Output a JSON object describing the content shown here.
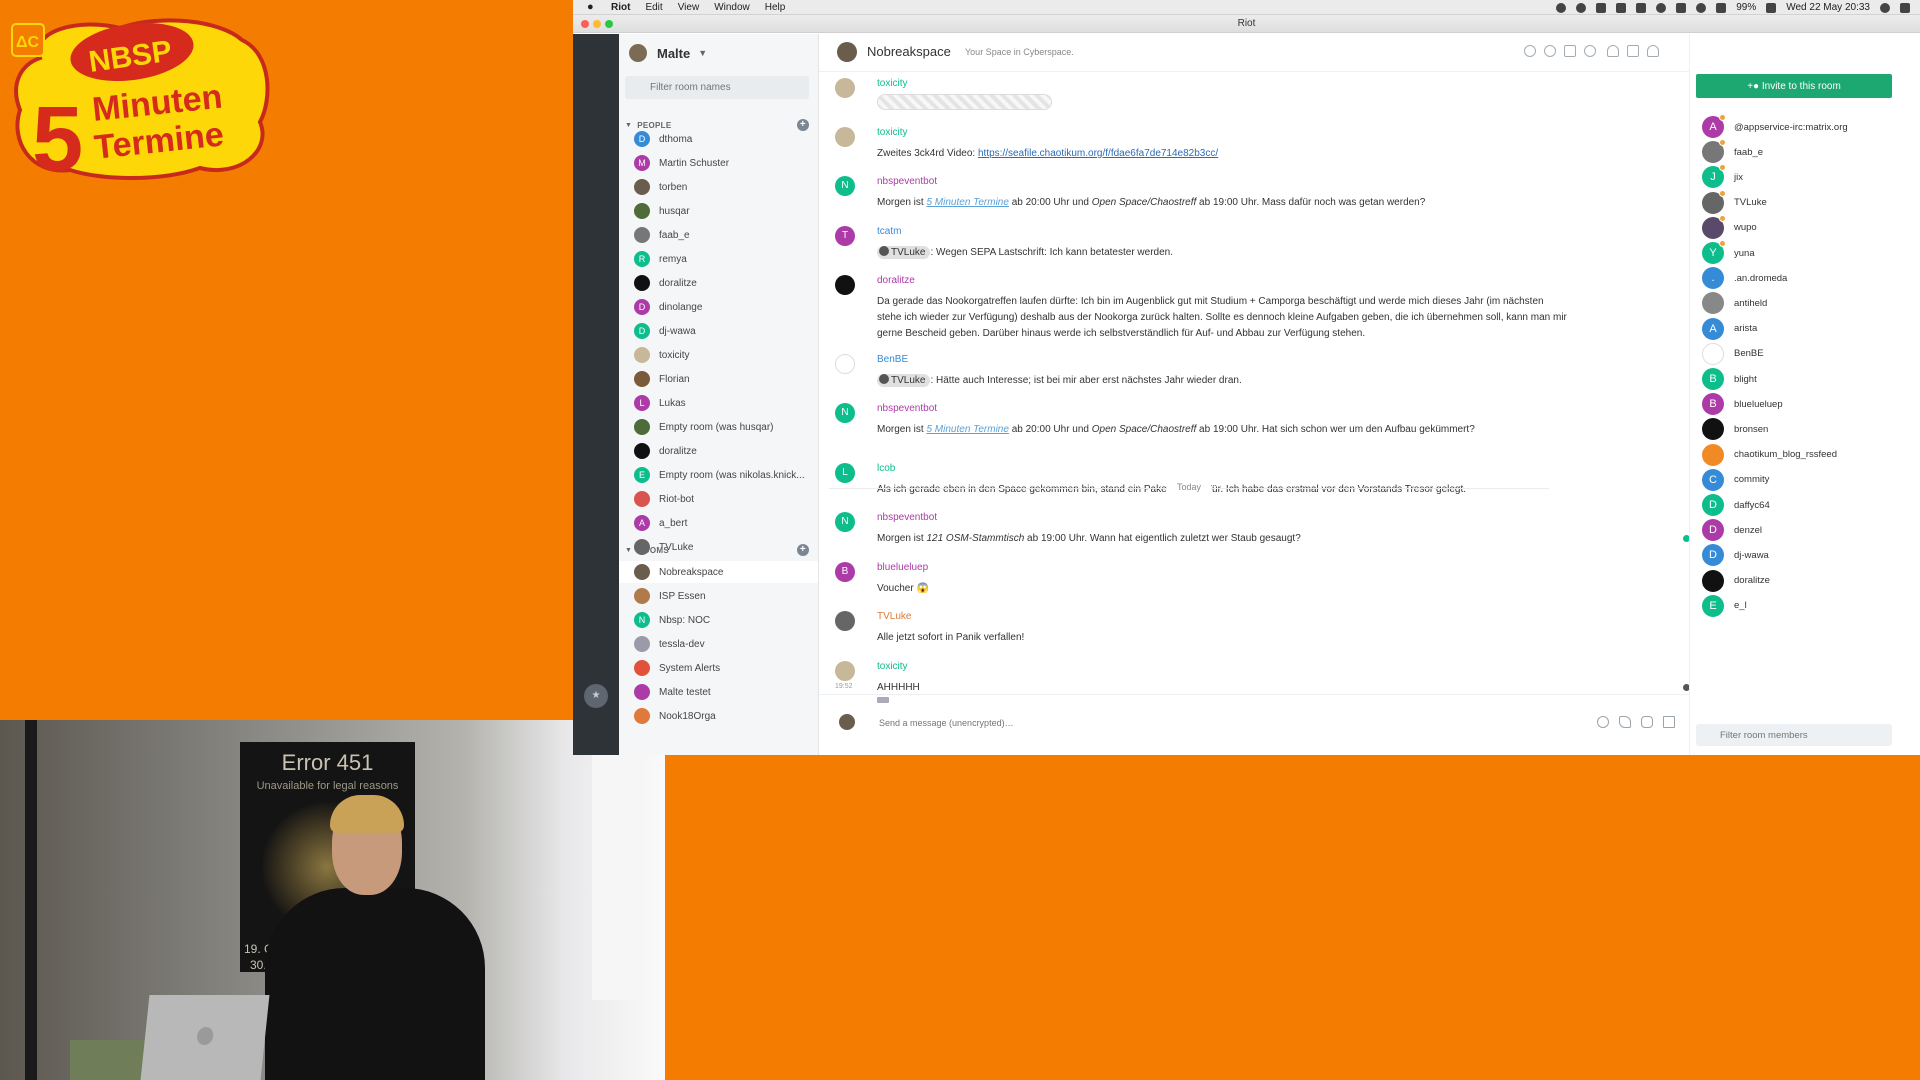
{
  "logo": {
    "line1": "NBSP",
    "line2": "5",
    "line3": "Minuten",
    "line4": "Termine",
    "badge": "ΔC"
  },
  "webcam": {
    "poster_title": "Error 451",
    "poster_subtitle": "Unavailable for legal reasons",
    "poster_date1": "19. G",
    "poster_date2": "30."
  },
  "menubar": {
    "app": "Riot",
    "items": [
      "Edit",
      "View",
      "Window",
      "Help"
    ],
    "battery": "99%",
    "datetime": "Wed 22 May  20:33"
  },
  "window": {
    "title": "Riot"
  },
  "user": {
    "name": "Malte"
  },
  "roomlist": {
    "filter_placeholder": "Filter room names",
    "people_label": "PEOPLE",
    "rooms_label": "ROOMS",
    "people": [
      {
        "name": "dthoma",
        "letter": "D",
        "color": "#368bd6"
      },
      {
        "name": "Martin Schuster",
        "letter": "M",
        "color": "#ac3ba8"
      },
      {
        "name": "torben",
        "letter": "",
        "color": "#6b5d4d"
      },
      {
        "name": "husqar",
        "letter": "",
        "color": "#4e6b3a"
      },
      {
        "name": "faab_e",
        "letter": "",
        "color": "#777"
      },
      {
        "name": "remya",
        "letter": "R",
        "color": "#0dbd8b"
      },
      {
        "name": "doralitze",
        "letter": "",
        "color": "#111"
      },
      {
        "name": "dinolange",
        "letter": "D",
        "color": "#ac3ba8"
      },
      {
        "name": "dj-wawa",
        "letter": "D",
        "color": "#0dbd8b"
      },
      {
        "name": "toxicity",
        "letter": "",
        "color": "#c8b89a"
      },
      {
        "name": "Florian",
        "letter": "",
        "color": "#7a5a3a"
      },
      {
        "name": "Lukas",
        "letter": "L",
        "color": "#ac3ba8"
      },
      {
        "name": "Empty room (was husqar)",
        "letter": "",
        "color": "#4e6b3a"
      },
      {
        "name": "doralitze",
        "letter": "",
        "color": "#111"
      },
      {
        "name": "Empty room (was nikolas.knick...",
        "letter": "E",
        "color": "#0dbd8b"
      },
      {
        "name": "Riot-bot",
        "letter": "",
        "color": "#d9534f"
      },
      {
        "name": "a_bert",
        "letter": "A",
        "color": "#ac3ba8"
      },
      {
        "name": "TVLuke",
        "letter": "",
        "color": "#666"
      }
    ],
    "rooms": [
      {
        "name": "Nobreakspace",
        "letter": "",
        "color": "#6b5d4d",
        "active": true
      },
      {
        "name": "ISP Essen",
        "letter": "",
        "color": "#b07a4a"
      },
      {
        "name": "Nbsp: NOC",
        "letter": "N",
        "color": "#0dbd8b"
      },
      {
        "name": "tessla-dev",
        "letter": "",
        "color": "#9a9aa8"
      },
      {
        "name": "System Alerts",
        "letter": "",
        "color": "#e0533a"
      },
      {
        "name": "Malte testet",
        "letter": "",
        "color": "#ac3ba8"
      },
      {
        "name": "Nook18Orga",
        "letter": "",
        "color": "#e07a3a"
      }
    ]
  },
  "room": {
    "name": "Nobreakspace",
    "topic": "Your Space in Cyberspace.",
    "today_label": "Today",
    "composer_placeholder": "Send a message (unencrypted)…",
    "messages": [
      {
        "sender": "toxicity",
        "sender_color": "#0dbd8b",
        "av_color": "#c8b89a",
        "letter": "",
        "kind": "placeholder"
      },
      {
        "sender": "toxicity",
        "sender_color": "#0dbd8b",
        "av_color": "#c8b89a",
        "letter": "",
        "kind": "link",
        "text": "Zweites 3ck4rd Video: ",
        "link": "https://seafile.chaotikum.org/f/fdae6fa7de714e82b3cc/"
      },
      {
        "sender": "nbspeventbot",
        "sender_color": "#ac3ba8",
        "av_color": "#0dbd8b",
        "letter": "N",
        "kind": "event1",
        "pre": "Morgen ist ",
        "lk": "5 Minuten Termine",
        "mid": " ab 20:00 Uhr und ",
        "it": "Open Space/Chaostreff",
        "post": " ab 19:00 Uhr. Mass dafür noch was getan werden?"
      },
      {
        "sender": "tcatm",
        "sender_color": "#368bd6",
        "av_color": "#ac3ba8",
        "letter": "T",
        "kind": "pill",
        "pill": "TVLuke",
        "text": ": Wegen SEPA Lastschrift: Ich kann betatester werden."
      },
      {
        "sender": "doralitze",
        "sender_color": "#ac3ba8",
        "av_color": "#111",
        "letter": "",
        "kind": "text",
        "text": "Da gerade das Nookorgatreffen laufen dürfte: Ich bin im Augenblick gut mit Studium + Camporga beschäftigt und werde mich dieses Jahr (im nächsten stehe ich wieder zur Verfügung) deshalb aus der Nookorga zurück halten. Sollte es dennoch kleine Aufgaben geben, die ich übernehmen soll, kann man mir gerne Bescheid geben. Darüber hinaus werde ich selbstverständlich für Auf- und Abbau zur Verfügung stehen."
      },
      {
        "sender": "BenBE",
        "sender_color": "#368bd6",
        "av_color": "#fff",
        "letter": "",
        "kind": "pill",
        "pill": "TVLuke",
        "text": ": Hätte auch Interesse; ist bei mir aber erst nächstes Jahr wieder dran."
      },
      {
        "sender": "nbspeventbot",
        "sender_color": "#ac3ba8",
        "av_color": "#0dbd8b",
        "letter": "N",
        "kind": "event1",
        "pre": "Morgen ist ",
        "lk": "5 Minuten Termine",
        "mid": " ab 20:00 Uhr und ",
        "it": "Open Space/Chaostreff",
        "post": " ab 19:00 Uhr. Hat sich schon wer um den Aufbau gekümmert?"
      },
      {
        "sender": "lcob",
        "sender_color": "#0dbd8b",
        "av_color": "#0dbd8b",
        "letter": "L",
        "kind": "text",
        "text": "Als ich gerade eben in den Space gekommen bin, stand ein Paket vor der Tür. Ich habe das erstmal vor den Vorstands Tresor gelegt."
      },
      {
        "sender": "nbspeventbot",
        "sender_color": "#ac3ba8",
        "av_color": "#0dbd8b",
        "letter": "N",
        "kind": "event2",
        "pre": "Morgen ist ",
        "it": "121 OSM-Stammtisch",
        "post": " ab 19:00 Uhr. Wann hat eigentlich zuletzt wer Staub gesaugt?"
      },
      {
        "sender": "bluelueluep",
        "sender_color": "#ac3ba8",
        "av_color": "#ac3ba8",
        "letter": "B",
        "kind": "text",
        "text": "Voucher 😱"
      },
      {
        "sender": "TVLuke",
        "sender_color": "#e07a3a",
        "av_color": "#666",
        "letter": "",
        "kind": "text",
        "text": "Alle jetzt sofort in Panik verfallen!"
      },
      {
        "sender": "toxicity",
        "sender_color": "#0dbd8b",
        "av_color": "#c8b89a",
        "letter": "",
        "kind": "text",
        "text": "AHHHHH",
        "time": "19:52"
      }
    ]
  },
  "members": {
    "invite_label": "Invite to this room",
    "filter_placeholder": "Filter room members",
    "list": [
      {
        "name": "@appservice-irc:matrix.org",
        "letter": "A",
        "color": "#ac3ba8",
        "mod": true
      },
      {
        "name": "faab_e",
        "letter": "",
        "color": "#777",
        "mod": true
      },
      {
        "name": "jix",
        "letter": "J",
        "color": "#0dbd8b",
        "mod": true
      },
      {
        "name": "TVLuke",
        "letter": "",
        "color": "#666",
        "mod": true
      },
      {
        "name": "wupo",
        "letter": "",
        "color": "#5a4a6a",
        "mod": true
      },
      {
        "name": "yuna",
        "letter": "Y",
        "color": "#0dbd8b",
        "mod": true
      },
      {
        "name": ".an.dromeda",
        "letter": ".",
        "color": "#368bd6",
        "mod": false
      },
      {
        "name": "antiheld",
        "letter": "",
        "color": "#888",
        "mod": false
      },
      {
        "name": "arista",
        "letter": "A",
        "color": "#368bd6",
        "mod": false
      },
      {
        "name": "BenBE",
        "letter": "",
        "color": "#fff",
        "mod": false
      },
      {
        "name": "blight",
        "letter": "B",
        "color": "#0dbd8b",
        "mod": false
      },
      {
        "name": "bluelueluep",
        "letter": "B",
        "color": "#ac3ba8",
        "mod": false
      },
      {
        "name": "bronsen",
        "letter": "",
        "color": "#111",
        "mod": false
      },
      {
        "name": "chaotikum_blog_rssfeed",
        "letter": "",
        "color": "#f08a24",
        "mod": false
      },
      {
        "name": "commity",
        "letter": "C",
        "color": "#368bd6",
        "mod": false
      },
      {
        "name": "daffyc64",
        "letter": "D",
        "color": "#0dbd8b",
        "mod": false
      },
      {
        "name": "denzel",
        "letter": "D",
        "color": "#ac3ba8",
        "mod": false
      },
      {
        "name": "dj-wawa",
        "letter": "D",
        "color": "#368bd6",
        "mod": false
      },
      {
        "name": "doralitze",
        "letter": "",
        "color": "#111",
        "mod": false
      },
      {
        "name": "e_l",
        "letter": "E",
        "color": "#0dbd8b",
        "mod": false
      }
    ]
  }
}
